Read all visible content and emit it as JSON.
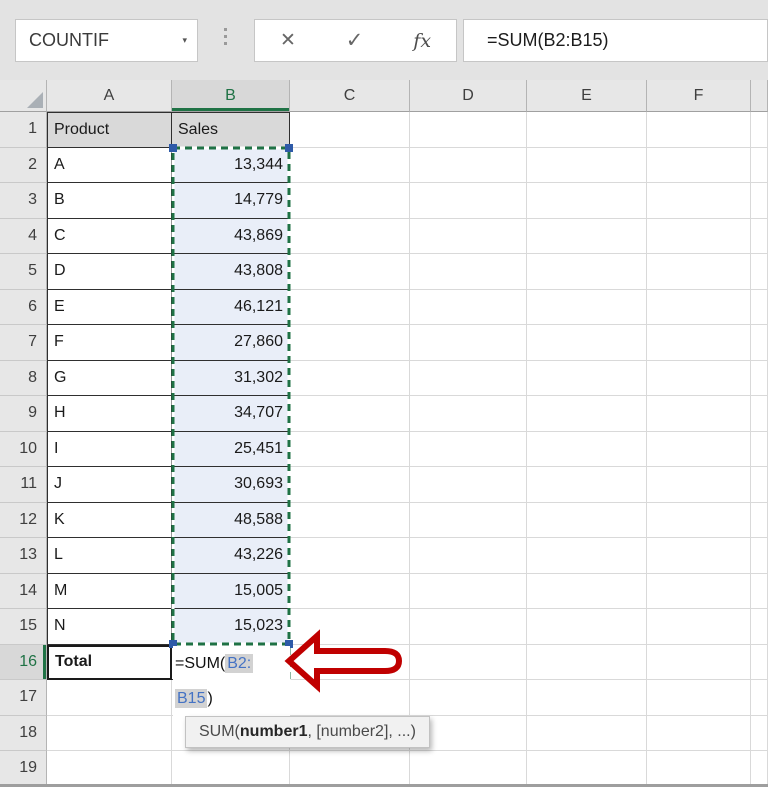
{
  "colors": {
    "accent_green": "#1f7245",
    "ref_blue": "#4472c4",
    "handle_blue": "#2e5aa8",
    "arrow_red": "#c00000",
    "range_fill": "#e9eef8",
    "table_header_fill": "#d9d9d9",
    "chrome_bg": "#e3e3e3",
    "tooltip_bg": "#f1f1f1"
  },
  "chrome": {
    "name_box_value": "COUNTIF",
    "name_box_caret": "▾",
    "cancel_icon": "✕",
    "enter_icon": "✓",
    "insert_function_icon": "fx",
    "formula_bar_value": "=SUM(B2:B15)"
  },
  "sheet": {
    "column_headers": [
      "A",
      "B",
      "C",
      "D",
      "E",
      "F",
      ""
    ],
    "active_column": "B",
    "active_row": "16",
    "rows": [
      {
        "n": "1",
        "a": "Product",
        "b": "Sales"
      },
      {
        "n": "2",
        "a": "A",
        "b": "13,344"
      },
      {
        "n": "3",
        "a": "B",
        "b": "14,779"
      },
      {
        "n": "4",
        "a": "C",
        "b": "43,869"
      },
      {
        "n": "5",
        "a": "D",
        "b": "43,808"
      },
      {
        "n": "6",
        "a": "E",
        "b": "46,121"
      },
      {
        "n": "7",
        "a": "F",
        "b": "27,860"
      },
      {
        "n": "8",
        "a": "G",
        "b": "31,302"
      },
      {
        "n": "9",
        "a": "H",
        "b": "34,707"
      },
      {
        "n": "10",
        "a": "I",
        "b": "25,451"
      },
      {
        "n": "11",
        "a": "J",
        "b": "30,693"
      },
      {
        "n": "12",
        "a": "K",
        "b": "48,588"
      },
      {
        "n": "13",
        "a": "L",
        "b": "43,226"
      },
      {
        "n": "14",
        "a": "M",
        "b": "15,005"
      },
      {
        "n": "15",
        "a": "N",
        "b": "15,023"
      },
      {
        "n": "16",
        "a": "Total",
        "b": ""
      },
      {
        "n": "17",
        "a": "",
        "b": ""
      },
      {
        "n": "18",
        "a": "",
        "b": ""
      },
      {
        "n": "19",
        "a": "",
        "b": ""
      }
    ]
  },
  "edit_cell": {
    "line1_prefix": "=SUM(",
    "line1_ref": "B2:",
    "line2_ref": "B15",
    "line2_suffix": ")"
  },
  "tooltip": {
    "prefix": "SUM(",
    "bold_arg": "number1",
    "suffix": ", [number2], ...)"
  }
}
